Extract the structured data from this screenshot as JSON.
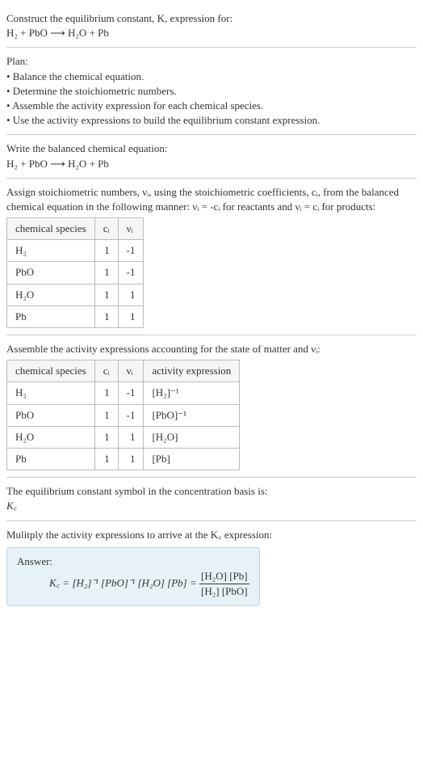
{
  "header": {
    "prompt": "Construct the equilibrium constant, K, expression for:",
    "equation": "H₂ + PbO ⟶ H₂O + Pb"
  },
  "plan": {
    "title": "Plan:",
    "b1": "• Balance the chemical equation.",
    "b2": "• Determine the stoichiometric numbers.",
    "b3": "• Assemble the activity expression for each chemical species.",
    "b4": "• Use the activity expressions to build the equilibrium constant expression."
  },
  "balanced": {
    "title": "Write the balanced chemical equation:",
    "equation": "H₂ + PbO ⟶ H₂O + Pb"
  },
  "stoich": {
    "intro1": "Assign stoichiometric numbers, νᵢ, using the stoichiometric coefficients, cᵢ, from the balanced chemical equation in the following manner: νᵢ = -cᵢ for reactants and νᵢ = cᵢ for products:",
    "headers": {
      "species": "chemical species",
      "ci": "cᵢ",
      "vi": "νᵢ"
    },
    "rows": [
      {
        "species": "H₂",
        "ci": "1",
        "vi": "-1"
      },
      {
        "species": "PbO",
        "ci": "1",
        "vi": "-1"
      },
      {
        "species": "H₂O",
        "ci": "1",
        "vi": "1"
      },
      {
        "species": "Pb",
        "ci": "1",
        "vi": "1"
      }
    ]
  },
  "activity": {
    "intro": "Assemble the activity expressions accounting for the state of matter and νᵢ:",
    "headers": {
      "species": "chemical species",
      "ci": "cᵢ",
      "vi": "νᵢ",
      "expr": "activity expression"
    },
    "rows": [
      {
        "species": "H₂",
        "ci": "1",
        "vi": "-1",
        "expr": "[H₂]⁻¹"
      },
      {
        "species": "PbO",
        "ci": "1",
        "vi": "-1",
        "expr": "[PbO]⁻¹"
      },
      {
        "species": "H₂O",
        "ci": "1",
        "vi": "1",
        "expr": "[H₂O]"
      },
      {
        "species": "Pb",
        "ci": "1",
        "vi": "1",
        "expr": "[Pb]"
      }
    ]
  },
  "symbol": {
    "intro": "The equilibrium constant symbol in the concentration basis is:",
    "kc": "K꜀"
  },
  "final": {
    "intro": "Mulitply the activity expressions to arrive at the K꜀ expression:",
    "answer_label": "Answer:",
    "lhs": "K꜀ = [H₂]⁻¹ [PbO]⁻¹ [H₂O] [Pb] = ",
    "numerator": "[H₂O] [Pb]",
    "denominator": "[H₂] [PbO]"
  }
}
